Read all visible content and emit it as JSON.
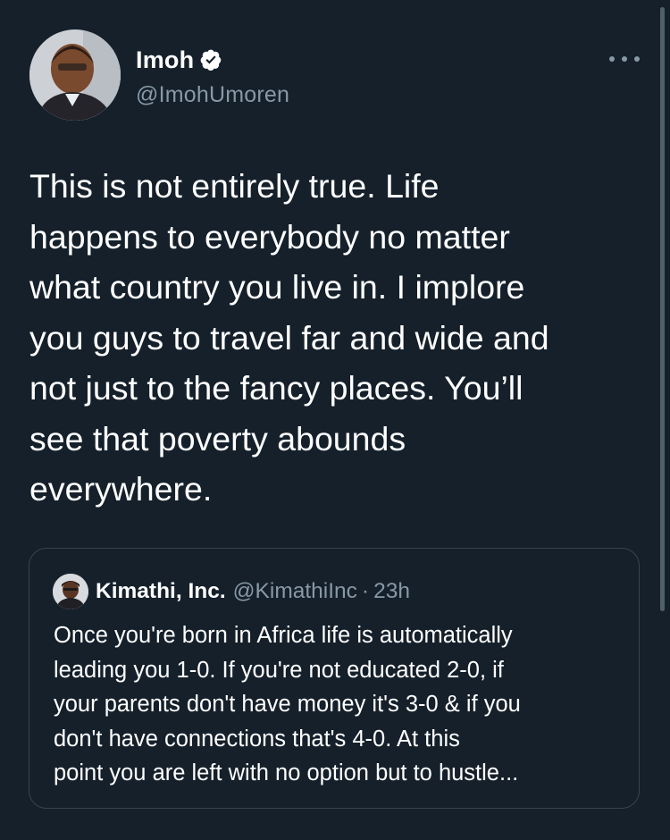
{
  "author": {
    "display_name": "Imoh",
    "handle": "@ImohUmoren",
    "verified": true,
    "avatar_icon": "user-avatar-photo"
  },
  "tweet": {
    "text": "This is not entirely true. Life\nhappens to everybody no matter\nwhat country you live in. I implore\nyou guys to travel far and wide and\nnot just to the fancy places. You’ll\nsee that poverty abounds\neverywhere."
  },
  "quoted_tweet": {
    "display_name": "Kimathi, Inc.",
    "handle": "@KimathiInc",
    "separator": "·",
    "time": "23h",
    "text": "Once you're born in Africa life is automatically\nleading you 1-0. If you're not educated 2-0, if\nyour parents don't have money it's 3-0 & if you\ndon't have connections that's 4-0. At this\npoint you are left with no option but to hustle..."
  },
  "colors": {
    "background": "#15202b",
    "secondary_text": "#8899a6",
    "border": "#38444d",
    "verified_badge": "#ffffff"
  },
  "icons": {
    "more": "more-horizontal-icon",
    "verified": "verified-badge-icon"
  }
}
